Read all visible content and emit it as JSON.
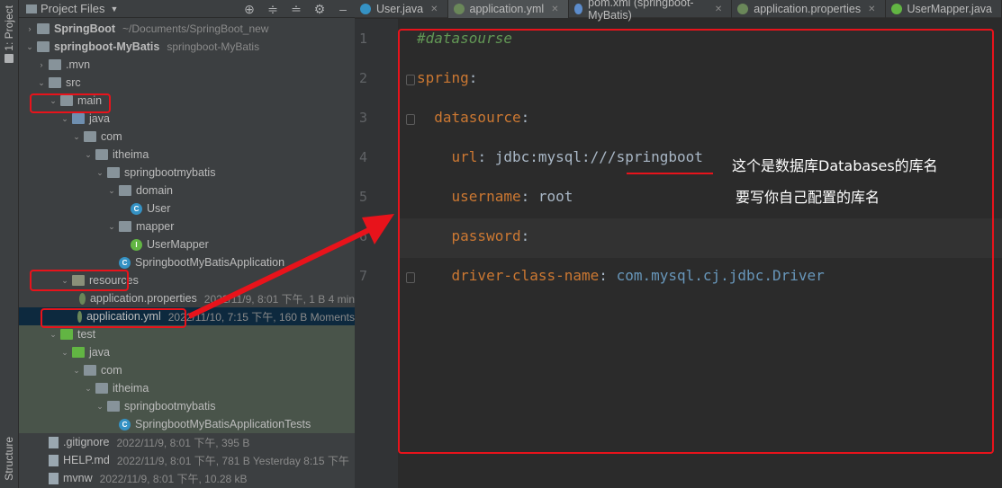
{
  "sidebar": {
    "project_label": "1: Project",
    "structure_label": "Structure"
  },
  "project_panel": {
    "title": "Project Files",
    "tools": [
      "target-icon",
      "collapse-icon",
      "expand-icon",
      "gear-icon",
      "minimize-icon"
    ]
  },
  "tree": [
    {
      "indent": 0,
      "arrow": "›",
      "icon": "folder",
      "name": "SpringBoot",
      "bold": true,
      "meta": "~/Documents/SpringBoot_new"
    },
    {
      "indent": 0,
      "arrow": "⌄",
      "icon": "folder",
      "name": "springboot-MyBatis",
      "bold": true,
      "meta": "springboot-MyBatis"
    },
    {
      "indent": 1,
      "arrow": "›",
      "icon": "folder",
      "name": ".mvn",
      "meta": ""
    },
    {
      "indent": 1,
      "arrow": "⌄",
      "icon": "folder",
      "name": "src",
      "meta": ""
    },
    {
      "indent": 2,
      "arrow": "⌄",
      "icon": "folder",
      "name": "main",
      "meta": ""
    },
    {
      "indent": 3,
      "arrow": "⌄",
      "icon": "folder blue",
      "name": "java",
      "meta": ""
    },
    {
      "indent": 4,
      "arrow": "⌄",
      "icon": "folder",
      "name": "com",
      "meta": ""
    },
    {
      "indent": 5,
      "arrow": "⌄",
      "icon": "folder",
      "name": "itheima",
      "meta": ""
    },
    {
      "indent": 6,
      "arrow": "⌄",
      "icon": "folder",
      "name": "springbootmybatis",
      "meta": ""
    },
    {
      "indent": 7,
      "arrow": "⌄",
      "icon": "folder",
      "name": "domain",
      "meta": ""
    },
    {
      "indent": 8,
      "arrow": "",
      "icon": "cls",
      "name": "User",
      "meta": ""
    },
    {
      "indent": 7,
      "arrow": "⌄",
      "icon": "folder",
      "name": "mapper",
      "meta": ""
    },
    {
      "indent": 8,
      "arrow": "",
      "icon": "intf",
      "name": "UserMapper",
      "meta": ""
    },
    {
      "indent": 7,
      "arrow": "",
      "icon": "cls",
      "name": "SpringbootMyBatisApplication",
      "meta": ""
    },
    {
      "indent": 3,
      "arrow": "⌄",
      "icon": "folder res",
      "name": "resources",
      "meta": ""
    },
    {
      "indent": 4,
      "arrow": "",
      "icon": "leaf",
      "name": "application.properties",
      "meta": "2022/11/9, 8:01 下午, 1 B 4 min"
    },
    {
      "indent": 4,
      "arrow": "",
      "icon": "leaf",
      "name": "application.yml",
      "meta": "2022/11/10, 7:15 下午, 160 B Moments",
      "selected": true
    },
    {
      "indent": 2,
      "arrow": "⌄",
      "icon": "folder green",
      "name": "test",
      "meta": "",
      "test": true
    },
    {
      "indent": 3,
      "arrow": "⌄",
      "icon": "folder green",
      "name": "java",
      "meta": "",
      "test": true
    },
    {
      "indent": 4,
      "arrow": "⌄",
      "icon": "folder",
      "name": "com",
      "meta": "",
      "test": true
    },
    {
      "indent": 5,
      "arrow": "⌄",
      "icon": "folder",
      "name": "itheima",
      "meta": "",
      "test": true
    },
    {
      "indent": 6,
      "arrow": "⌄",
      "icon": "folder",
      "name": "springbootmybatis",
      "meta": "",
      "test": true
    },
    {
      "indent": 7,
      "arrow": "",
      "icon": "cls",
      "name": "SpringbootMyBatisApplicationTests",
      "meta": "",
      "test": true
    },
    {
      "indent": 1,
      "arrow": "",
      "icon": "file",
      "name": ".gitignore",
      "meta": "2022/11/9, 8:01 下午, 395 B"
    },
    {
      "indent": 1,
      "arrow": "",
      "icon": "file",
      "name": "HELP.md",
      "meta": "2022/11/9, 8:01 下午, 781 B Yesterday 8:15 下午"
    },
    {
      "indent": 1,
      "arrow": "",
      "icon": "file",
      "name": "mvnw",
      "meta": "2022/11/9, 8:01 下午, 10.28 kB"
    }
  ],
  "tabs": [
    {
      "label": "User.java",
      "icon": "class-icon",
      "color": "#3592c4",
      "active": false
    },
    {
      "label": "application.yml",
      "icon": "spring-leaf-icon",
      "color": "#6a8759",
      "active": true
    },
    {
      "label": "pom.xml (springboot-MyBatis)",
      "icon": "maven-icon",
      "color": "#5c8ccc",
      "active": false
    },
    {
      "label": "application.properties",
      "icon": "spring-leaf-icon",
      "color": "#6a8759",
      "active": false
    },
    {
      "label": "UserMapper.java",
      "icon": "interface-icon",
      "color": "#62b543",
      "active": false
    }
  ],
  "code_lines": [
    {
      "num": "1",
      "parts": [
        {
          "t": "#datasourse",
          "c": "c"
        }
      ]
    },
    {
      "num": "2",
      "parts": [
        {
          "t": "spring",
          "c": "k"
        },
        {
          "t": ":",
          "c": "v"
        }
      ]
    },
    {
      "num": "3",
      "parts": [
        {
          "t": "  datasource",
          "c": "k"
        },
        {
          "t": ":",
          "c": "v"
        }
      ]
    },
    {
      "num": "4",
      "parts": [
        {
          "t": "    url",
          "c": "k"
        },
        {
          "t": ": jdbc:mysql:///springboot",
          "c": "v"
        }
      ]
    },
    {
      "num": "5",
      "parts": [
        {
          "t": "    username",
          "c": "k"
        },
        {
          "t": ": root",
          "c": "v"
        }
      ]
    },
    {
      "num": "6",
      "parts": [
        {
          "t": "    password",
          "c": "k"
        },
        {
          "t": ":",
          "c": "v"
        }
      ]
    },
    {
      "num": "7",
      "parts": [
        {
          "t": "    driver-class-name",
          "c": "k"
        },
        {
          "t": ": ",
          "c": "v"
        },
        {
          "t": "com.mysql.cj.jdbc.Driver",
          "c": "d"
        }
      ]
    }
  ],
  "annotation": {
    "line1": "这个是数据库Databases的库名",
    "line2": "要写你自己配置的库名"
  }
}
